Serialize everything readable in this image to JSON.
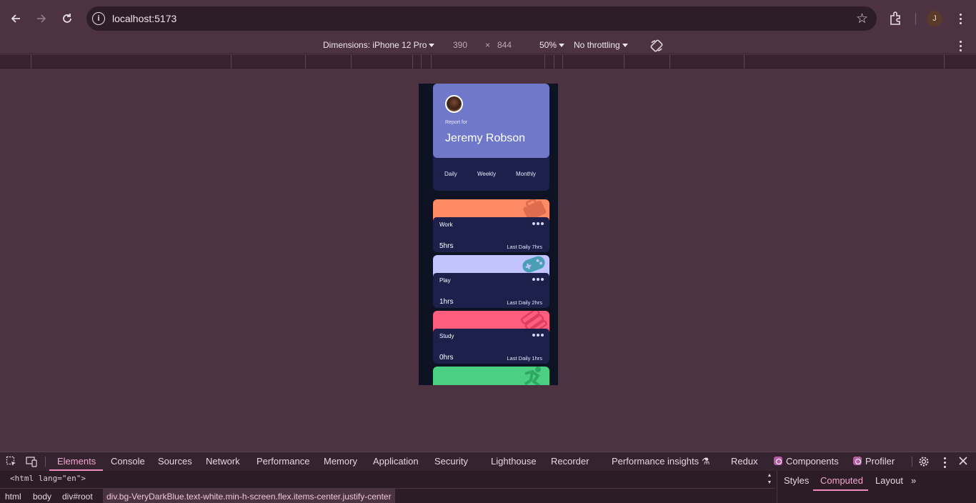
{
  "browser": {
    "url": "localhost:5173",
    "profile_initial": "J"
  },
  "device_toolbar": {
    "dimensions_label": "Dimensions: iPhone 12 Pro",
    "width": "390",
    "times": "×",
    "height": "844",
    "zoom": "50%",
    "throttling": "No throttling"
  },
  "app": {
    "report_for": "Report for",
    "user_name": "Jeremy Robson",
    "periods": [
      "Daily",
      "Weekly",
      "Monthly"
    ],
    "activities": [
      {
        "title": "Work",
        "hours": "5hrs",
        "last": "Last Daily 7hrs",
        "color": "#ff8b64"
      },
      {
        "title": "Play",
        "hours": "1hrs",
        "last": "Last Daily 2hrs",
        "color": "#c2c4ff"
      },
      {
        "title": "Study",
        "hours": "0hrs",
        "last": "Last Daily 1hrs",
        "color": "#ff5e7d"
      },
      {
        "title": "",
        "hours": "",
        "last": "",
        "color": "#4bcf82"
      }
    ]
  },
  "devtools": {
    "tabs": [
      "Elements",
      "Console",
      "Sources",
      "Network",
      "Performance",
      "Memory",
      "Application",
      "Security",
      "Lighthouse",
      "Recorder",
      "Performance insights",
      "Redux",
      "Components",
      "Profiler"
    ],
    "html_line": "<html lang=\"en\">",
    "breadcrumbs": [
      "html",
      "body",
      "div#root",
      "div.bg-VeryDarkBlue.text-white.min-h-screen.flex.items-center.justify-center"
    ],
    "side_tabs": [
      "Styles",
      "Computed",
      "Layout"
    ]
  }
}
